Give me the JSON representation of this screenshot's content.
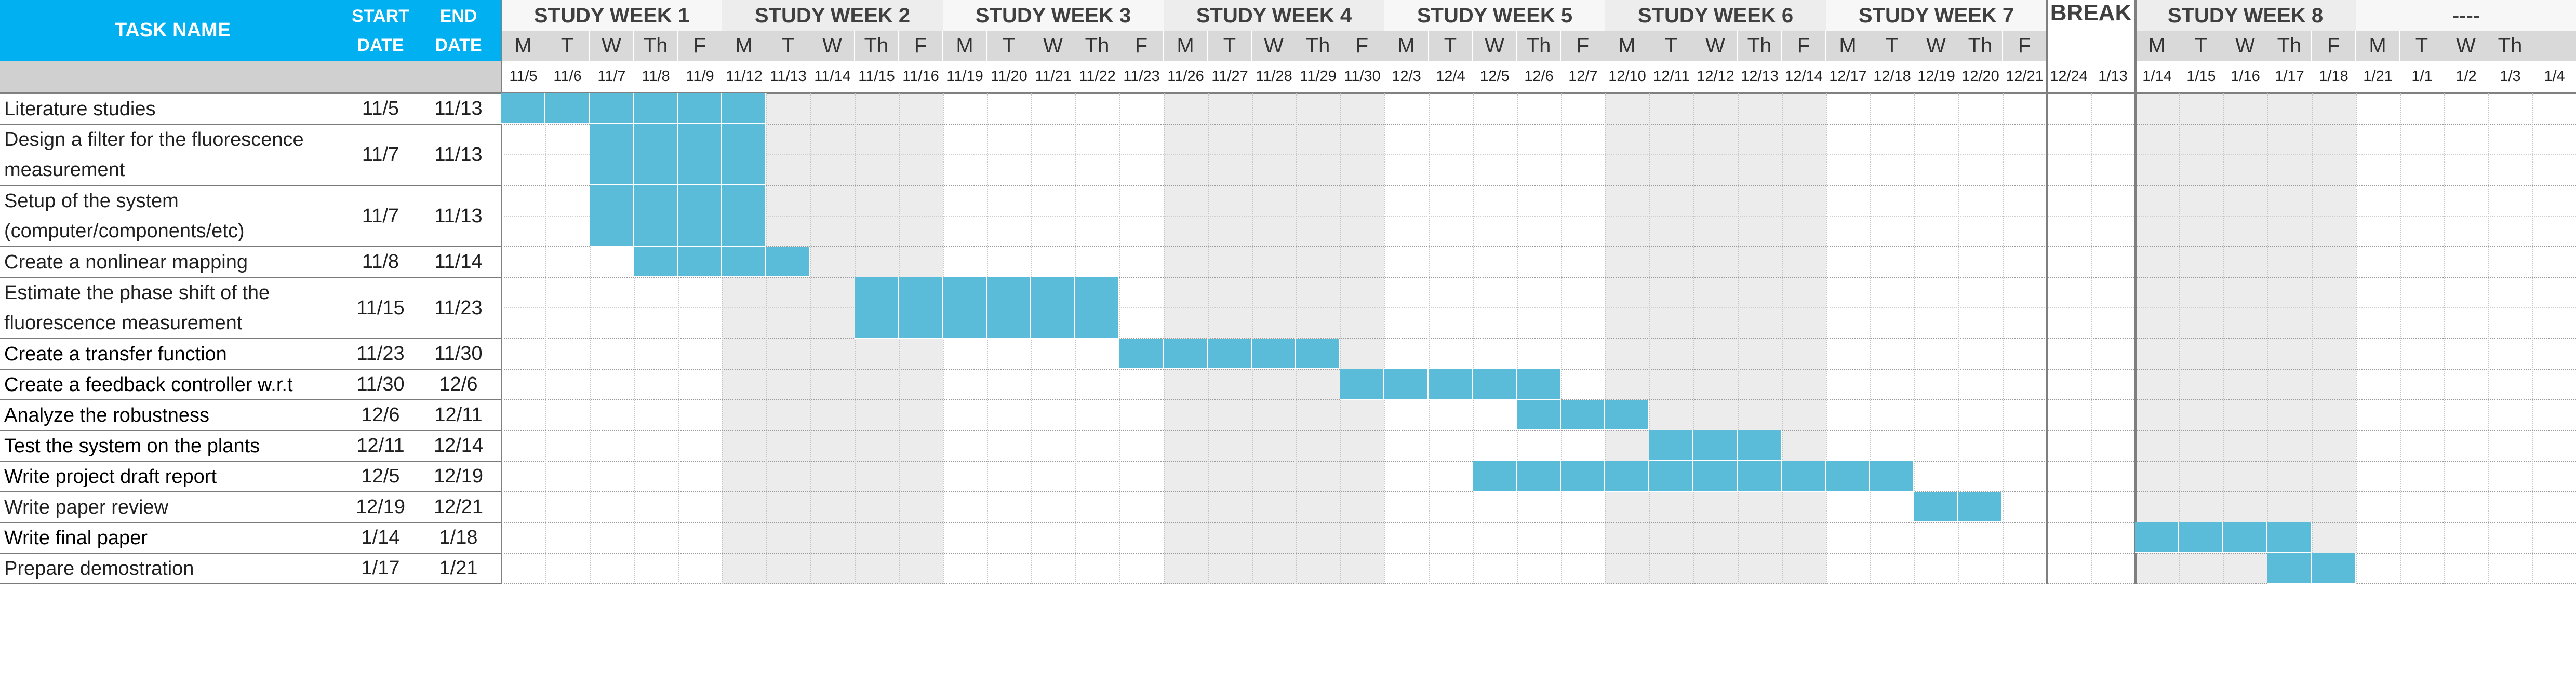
{
  "header": {
    "task_name": "TASK NAME",
    "start_date": "START\nDATE",
    "end_date": "END\nDATE"
  },
  "colors": {
    "header_blue": "#00b0f0",
    "bar": "#5bbcd9",
    "weekend_shade": "#ececec",
    "day_header_bg": "#d9d9d9",
    "alt_week_bg": "#ececec"
  },
  "chart_data": {
    "type": "gantt",
    "weeks": [
      {
        "label": "STUDY WEEK 1",
        "days": [
          "M",
          "T",
          "W",
          "Th",
          "F"
        ],
        "dates": [
          "11/5",
          "11/6",
          "11/7",
          "11/8",
          "11/9"
        ],
        "shaded": false
      },
      {
        "label": "STUDY WEEK 2",
        "days": [
          "M",
          "T",
          "W",
          "Th",
          "F"
        ],
        "dates": [
          "11/12",
          "11/13",
          "11/14",
          "11/15",
          "11/16"
        ],
        "shaded": true
      },
      {
        "label": "STUDY WEEK 3",
        "days": [
          "M",
          "T",
          "W",
          "Th",
          "F"
        ],
        "dates": [
          "11/19",
          "11/20",
          "11/21",
          "11/22",
          "11/23"
        ],
        "shaded": false
      },
      {
        "label": "STUDY WEEK 4",
        "days": [
          "M",
          "T",
          "W",
          "Th",
          "F"
        ],
        "dates": [
          "11/26",
          "11/27",
          "11/28",
          "11/29",
          "11/30"
        ],
        "shaded": true
      },
      {
        "label": "STUDY WEEK 5",
        "days": [
          "M",
          "T",
          "W",
          "Th",
          "F"
        ],
        "dates": [
          "12/3",
          "12/4",
          "12/5",
          "12/6",
          "12/7"
        ],
        "shaded": false
      },
      {
        "label": "STUDY WEEK 6",
        "days": [
          "M",
          "T",
          "W",
          "Th",
          "F"
        ],
        "dates": [
          "12/10",
          "12/11",
          "12/12",
          "12/13",
          "12/14"
        ],
        "shaded": true
      },
      {
        "label": "STUDY WEEK 7",
        "days": [
          "M",
          "T",
          "W",
          "Th",
          "F"
        ],
        "dates": [
          "12/17",
          "12/18",
          "12/19",
          "12/20",
          "12/21"
        ],
        "shaded": false
      },
      {
        "label": "BREAK",
        "days": [
          "",
          ""
        ],
        "dates": [
          "12/24",
          "1/13"
        ],
        "shaded": false,
        "is_break": true
      },
      {
        "label": "STUDY WEEK 8",
        "days": [
          "M",
          "T",
          "W",
          "Th",
          "F"
        ],
        "dates": [
          "1/14",
          "1/15",
          "1/16",
          "1/17",
          "1/18"
        ],
        "shaded": true
      },
      {
        "label": "----",
        "days": [
          "M",
          "T",
          "W",
          "Th"
        ],
        "dates": [
          "1/21",
          "1/1",
          "1/2",
          "1/3",
          "1/4"
        ],
        "shaded": false
      }
    ],
    "tasks": [
      {
        "name": "Literature studies",
        "start": "11/5",
        "end": "11/13",
        "bold": false,
        "lines": 1
      },
      {
        "name": "Design a filter for the fluorescence\nmeasurement",
        "start": "11/7",
        "end": "11/13",
        "bold": false,
        "lines": 2
      },
      {
        "name": "Setup of the system\n(computer/components/etc)",
        "start": "11/7",
        "end": "11/13",
        "bold": false,
        "lines": 2
      },
      {
        "name": "Create a nonlinear mapping",
        "start": "11/8",
        "end": "11/14",
        "bold": false,
        "lines": 1
      },
      {
        "name": "Estimate the phase shift of the\nfluorescence measurement",
        "start": "11/15",
        "end": "11/23",
        "bold": false,
        "lines": 2
      },
      {
        "name": "Create a transfer function",
        "start": "11/23",
        "end": "11/30",
        "bold": true,
        "lines": 1
      },
      {
        "name": "Create a feedback controller w.r.t",
        "start": "11/30",
        "end": "12/6",
        "bold": true,
        "lines": 1
      },
      {
        "name": "Analyze the robustness",
        "start": "12/6",
        "end": "12/11",
        "bold": true,
        "lines": 1
      },
      {
        "name": "Test the system on the plants",
        "start": "12/11",
        "end": "12/14",
        "bold": true,
        "lines": 1
      },
      {
        "name": "Write project draft report",
        "start": "12/5",
        "end": "12/19",
        "bold": true,
        "lines": 1
      },
      {
        "name": "Write paper review",
        "start": "12/19",
        "end": "12/21",
        "bold": false,
        "lines": 1
      },
      {
        "name": "Write final paper",
        "start": "1/14",
        "end": "1/18",
        "bold": true,
        "lines": 1
      },
      {
        "name": "Prepare demostration",
        "start": "1/17",
        "end": "1/21",
        "bold": false,
        "lines": 1
      }
    ],
    "bars": [
      {
        "task": 0,
        "from_col": 0,
        "to_col": 6
      },
      {
        "task": 1,
        "from_col": 2,
        "to_col": 6
      },
      {
        "task": 2,
        "from_col": 2,
        "to_col": 6
      },
      {
        "task": 3,
        "from_col": 3,
        "to_col": 7
      },
      {
        "task": 4,
        "from_col": 8,
        "to_col": 14
      },
      {
        "task": 5,
        "from_col": 14,
        "to_col": 19
      },
      {
        "task": 6,
        "from_col": 19,
        "to_col": 24
      },
      {
        "task": 7,
        "from_col": 23,
        "to_col": 26
      },
      {
        "task": 8,
        "from_col": 26,
        "to_col": 29
      },
      {
        "task": 9,
        "from_col": 22,
        "to_col": 32
      },
      {
        "task": 10,
        "from_col": 32,
        "to_col": 34
      },
      {
        "task": 11,
        "from_col": 37,
        "to_col": 41
      },
      {
        "task": 12,
        "from_col": 40,
        "to_col": 42
      }
    ]
  }
}
